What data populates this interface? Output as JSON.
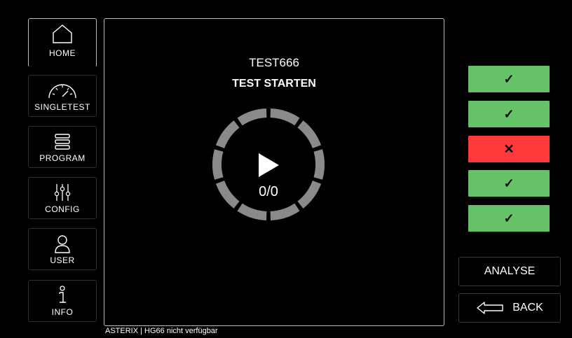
{
  "nav": {
    "items": [
      {
        "label": "HOME",
        "icon": "home-icon"
      },
      {
        "label": "SINGLETEST",
        "icon": "gauge-icon"
      },
      {
        "label": "PROGRAM",
        "icon": "stack-icon"
      },
      {
        "label": "CONFIG",
        "icon": "sliders-icon"
      },
      {
        "label": "USER",
        "icon": "user-icon"
      },
      {
        "label": "INFO",
        "icon": "info-icon"
      }
    ]
  },
  "main": {
    "test_name": "TEST666",
    "action_label": "TEST STARTEN",
    "counter": "0/0",
    "play_icon": "play-icon",
    "ring_color": "#8a8a8a"
  },
  "results": [
    {
      "status": "pass",
      "symbol": "✓",
      "color": "#66c266"
    },
    {
      "status": "pass",
      "symbol": "✓",
      "color": "#66c266"
    },
    {
      "status": "fail",
      "symbol": "✕",
      "color": "#ff3a3a"
    },
    {
      "status": "pass",
      "symbol": "✓",
      "color": "#66c266"
    },
    {
      "status": "pass",
      "symbol": "✓",
      "color": "#66c266"
    }
  ],
  "buttons": {
    "analyse": "ANALYSE",
    "back": "BACK",
    "back_icon": "arrow-left-icon"
  },
  "footer": {
    "status_text": "ASTERIX | HG66 nicht verfügbar"
  }
}
